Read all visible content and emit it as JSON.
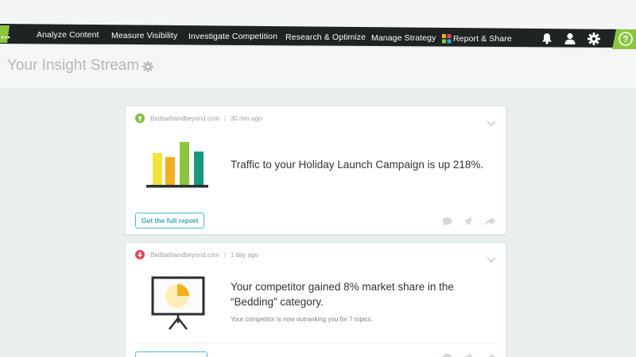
{
  "nav": {
    "items": [
      {
        "label": "Analyze Content"
      },
      {
        "label": "Measure Visibility"
      },
      {
        "label": "Investigate Competition"
      },
      {
        "label": "Research & Optimize"
      },
      {
        "label": "Manage Strategy"
      },
      {
        "label": "Report & Share"
      }
    ],
    "icons": [
      "bell-icon",
      "user-icon",
      "gear-icon",
      "help-icon"
    ],
    "help_glyph": "?",
    "colors": {
      "bar": "#1f2324",
      "accent": "#8cc63f"
    }
  },
  "header": {
    "title": "Your Insight Stream",
    "title_icon": "gear-icon"
  },
  "cards": [
    {
      "source": "Bedbathandbeyond.com",
      "separator": "|",
      "time": "30 min ago",
      "trend": "up",
      "trend_color": "#7dc243",
      "illustration": "bar-chart-icon",
      "headline": "Traffic to your Holiday Launch Campaign is up 218%.",
      "subline": "",
      "button_label": "Get the full report",
      "actions": [
        "comment-icon",
        "pin-icon",
        "share-icon"
      ]
    },
    {
      "source": "Bedbathandbeyond.com",
      "separator": "|",
      "time": "1 day ago",
      "trend": "down",
      "trend_color": "#e2485a",
      "illustration": "pie-chart-easel-icon",
      "headline": "Your competitor gained 8% market share in the “Bedding” category.",
      "subline": "Your competitor is now outranking you for 7 topics.",
      "button_label": "",
      "actions": [
        "comment-icon",
        "pin-icon",
        "share-icon"
      ]
    }
  ]
}
